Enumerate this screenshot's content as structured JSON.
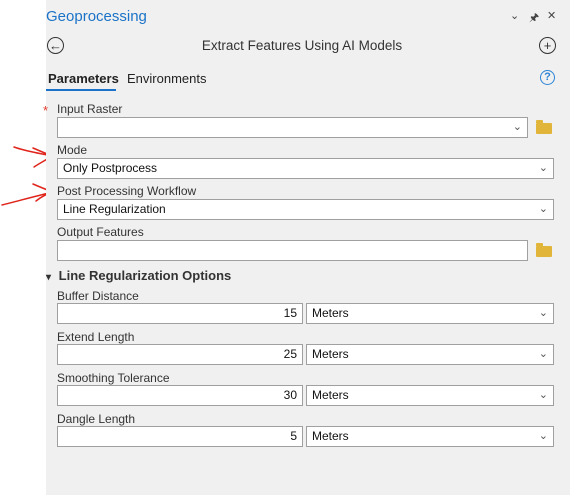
{
  "pane": {
    "title": "Geoprocessing",
    "window_buttons": [
      "⌄",
      "🖈",
      "✕"
    ]
  },
  "tool": {
    "title": "Extract Features Using AI Models",
    "back_symbol": "←",
    "add_symbol": "+"
  },
  "tabs": [
    {
      "label": "Parameters",
      "active": true
    },
    {
      "label": "Environments",
      "active": false
    }
  ],
  "help_symbol": "?",
  "required_marker": "*",
  "params": {
    "input_raster": {
      "label": "Input Raster",
      "value": ""
    },
    "mode": {
      "label": "Mode",
      "value": "Only Postprocess"
    },
    "workflow": {
      "label": "Post Processing Workflow",
      "value": "Line Regularization"
    },
    "output": {
      "label": "Output Features",
      "value": ""
    }
  },
  "section": {
    "label": "Line Regularization Options",
    "fields": [
      {
        "label": "Buffer Distance",
        "value": "15",
        "unit": "Meters"
      },
      {
        "label": "Extend Length",
        "value": "25",
        "unit": "Meters"
      },
      {
        "label": "Smoothing Tolerance",
        "value": "30",
        "unit": "Meters"
      },
      {
        "label": "Dangle Length",
        "value": "5",
        "unit": "Meters"
      }
    ]
  },
  "colors": {
    "accent": "#1a73c8",
    "annotation": "#e0241b",
    "folder": "#e1b53a"
  }
}
